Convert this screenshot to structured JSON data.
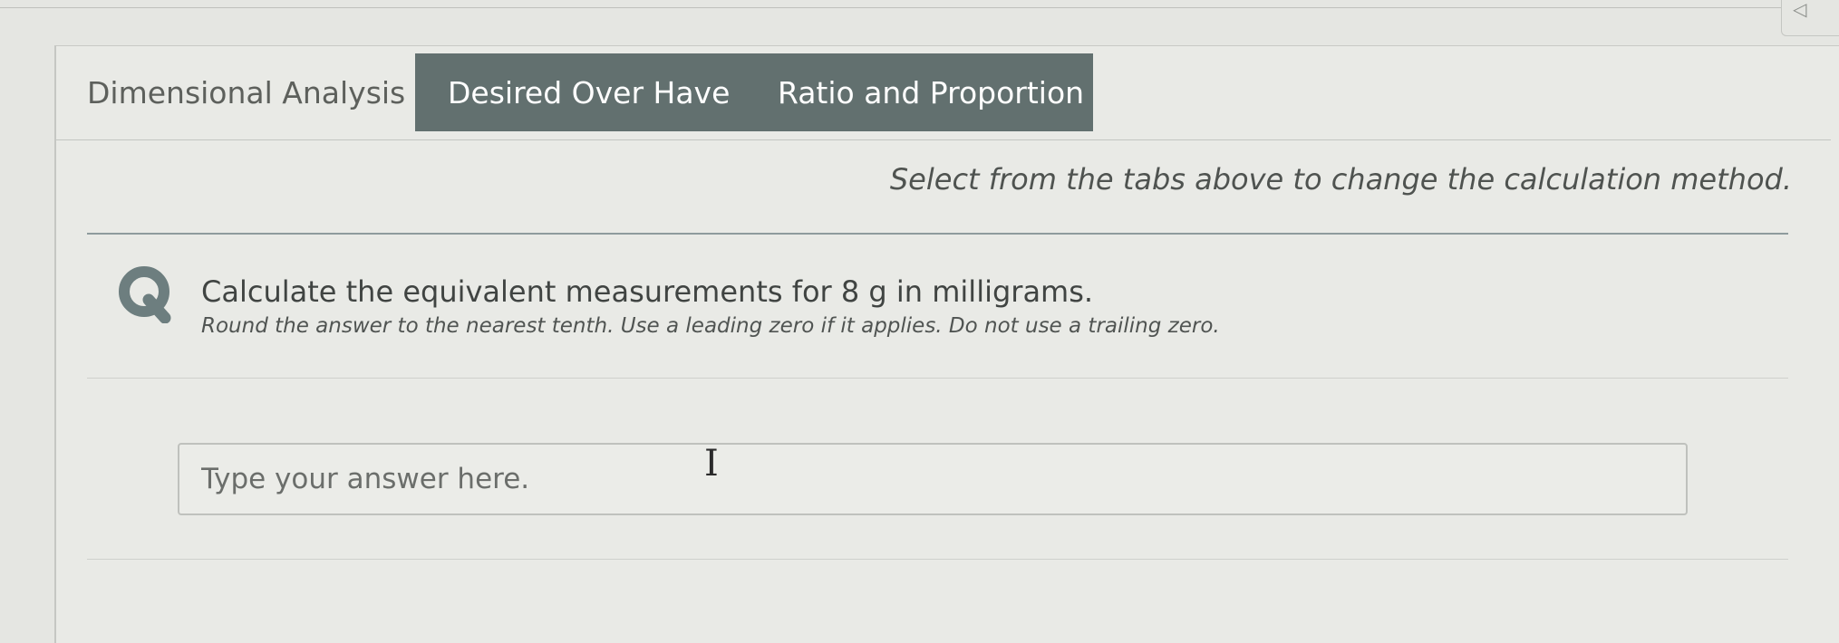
{
  "tabs": [
    {
      "label": "Dimensional Analysis",
      "active": true
    },
    {
      "label": "Desired Over Have",
      "active": false
    },
    {
      "label": "Ratio and Proportion",
      "active": false
    }
  ],
  "hint": "Select from the tabs above to change the calculation method.",
  "question": {
    "icon": "Q",
    "text": "Calculate the equivalent measurements for 8 g in milligrams.",
    "instruction": "Round the answer to the nearest tenth. Use a leading zero if it applies. Do not use a trailing zero."
  },
  "answer": {
    "placeholder": "Type your answer here.",
    "value": ""
  },
  "colors": {
    "tab_dark": "#62706f",
    "q_icon": "#6d7e7f",
    "background": "#e5e6e2"
  }
}
